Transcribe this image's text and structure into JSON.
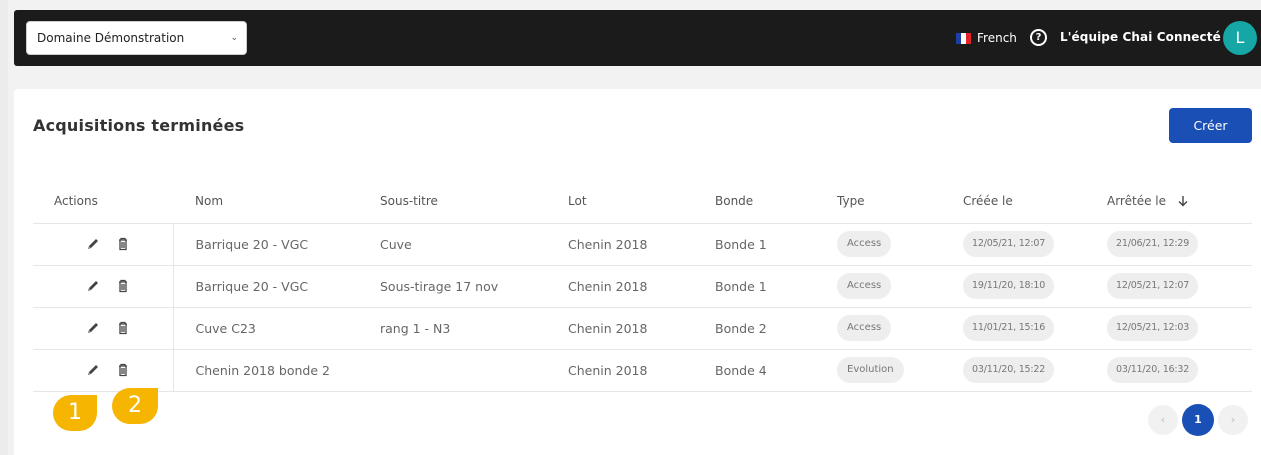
{
  "header": {
    "domain_select": "Domaine Démonstration",
    "language": "French",
    "team_name": "L'équipe Chai Connecté",
    "avatar_initial": "L",
    "help_symbol": "?"
  },
  "page": {
    "title": "Acquisitions terminées",
    "create_label": "Créer"
  },
  "table": {
    "columns": {
      "actions": "Actions",
      "nom": "Nom",
      "sous_titre": "Sous-titre",
      "lot": "Lot",
      "bonde": "Bonde",
      "type": "Type",
      "creee": "Créée le",
      "arretee": "Arrêtée le"
    },
    "rows": [
      {
        "nom": "Barrique 20 - VGC",
        "sous_titre": "Cuve",
        "lot": "Chenin 2018",
        "bonde": "Bonde 1",
        "type": "Access",
        "creee": "12/05/21, 12:07",
        "arretee": "21/06/21, 12:29"
      },
      {
        "nom": "Barrique 20 - VGC",
        "sous_titre": "Sous-tirage 17 nov",
        "lot": "Chenin 2018",
        "bonde": "Bonde 1",
        "type": "Access",
        "creee": "19/11/20, 18:10",
        "arretee": "12/05/21, 12:07"
      },
      {
        "nom": "Cuve C23",
        "sous_titre": "rang 1 - N3",
        "lot": "Chenin 2018",
        "bonde": "Bonde 2",
        "type": "Access",
        "creee": "11/01/21, 15:16",
        "arretee": "12/05/21, 12:03"
      },
      {
        "nom": "Chenin 2018 bonde 2",
        "sous_titre": "",
        "lot": "Chenin 2018",
        "bonde": "Bonde 4",
        "type": "Evolution",
        "creee": "03/11/20, 15:22",
        "arretee": "03/11/20, 16:32"
      }
    ]
  },
  "pagination": {
    "prev": "‹",
    "current": "1",
    "next": "›"
  },
  "annotations": {
    "badge_1": "1",
    "badge_2": "2"
  },
  "colors": {
    "topbar": "#1b1b1b",
    "primary": "#1a4fb5",
    "avatar": "#15a6a5",
    "annotation": "#f5b500"
  }
}
